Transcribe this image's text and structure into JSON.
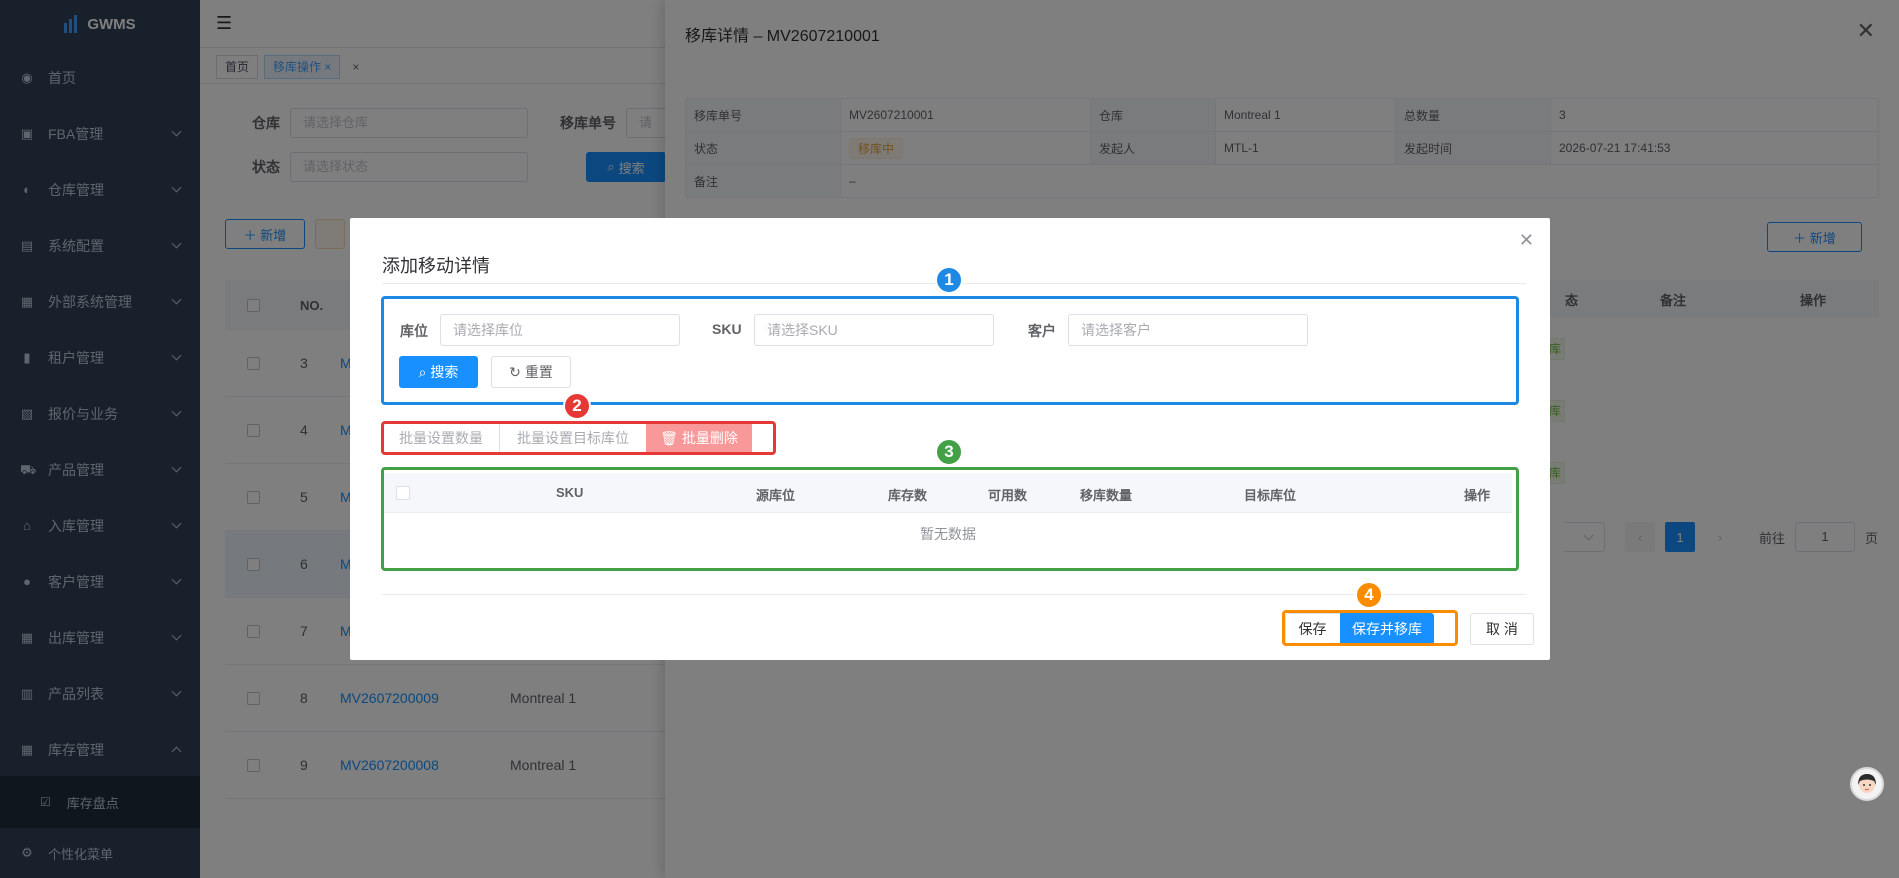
{
  "app": {
    "logo_text": "GWMS"
  },
  "sidebar": {
    "items": [
      {
        "label": "首页",
        "icon": "dashboard-icon"
      },
      {
        "label": "FBA管理",
        "icon": "fba-icon"
      },
      {
        "label": "仓库管理",
        "icon": "warehouse-icon"
      },
      {
        "label": "系统配置",
        "icon": "system-icon"
      },
      {
        "label": "外部系统管理",
        "icon": "grid-icon"
      },
      {
        "label": "租户管理",
        "icon": "chart-icon"
      },
      {
        "label": "报价与业务",
        "icon": "quote-icon"
      },
      {
        "label": "产品管理",
        "icon": "cart-icon"
      },
      {
        "label": "入库管理",
        "icon": "inbound-icon"
      },
      {
        "label": "客户管理",
        "icon": "user-icon"
      },
      {
        "label": "出库管理",
        "icon": "outbound-icon"
      },
      {
        "label": "产品列表",
        "icon": "book-icon"
      },
      {
        "label": "库存管理",
        "icon": "inventory-icon"
      }
    ],
    "sub_item": "库存盘点",
    "personal_menu": "个性化菜单"
  },
  "tags": {
    "home": "首页",
    "active": "移库操作"
  },
  "filters": {
    "warehouse_label": "仓库",
    "warehouse_placeholder": "请选择仓库",
    "move_no_label": "移库单号",
    "move_no_placeholder": "请",
    "status_label": "状态",
    "status_placeholder": "请选择状态",
    "search": "搜索"
  },
  "list": {
    "add": "新增",
    "col_no": "NO.",
    "rows": [
      {
        "no": "3",
        "code": "M"
      },
      {
        "no": "4",
        "code": "M"
      },
      {
        "no": "5",
        "code": "M"
      },
      {
        "no": "6",
        "code": "M"
      },
      {
        "no": "7",
        "code": "M"
      },
      {
        "no": "8",
        "code": "MV2607200009",
        "warehouse": "Montreal 1"
      },
      {
        "no": "9",
        "code": "MV2607200008",
        "warehouse": "Montreal 1"
      }
    ]
  },
  "drawer": {
    "title": "移库详情 – MV2607210001",
    "info": {
      "move_no_label": "移库单号",
      "move_no": "MV2607210001",
      "warehouse_label": "仓库",
      "warehouse": "Montreal 1",
      "total_label": "总数量",
      "total": "3",
      "status_label": "状态",
      "status": "移库中",
      "initiator_label": "发起人",
      "initiator": "MTL-1",
      "time_label": "发起时间",
      "time": "2026-07-21 17:41:53",
      "remark_label": "备注",
      "remark": "–"
    },
    "add": "新增",
    "cols": {
      "status_tail": "态",
      "remark": "备注",
      "op": "操作"
    },
    "tag_text": "库",
    "pager": {
      "current": "1",
      "goto": "前往",
      "goto_value": "1",
      "page": "页"
    }
  },
  "dialog": {
    "title": "添加移动详情",
    "location_label": "库位",
    "location_placeholder": "请选择库位",
    "sku_label": "SKU",
    "sku_placeholder": "请选择SKU",
    "customer_label": "客户",
    "customer_placeholder": "请选择客户",
    "search": "搜索",
    "reset": "重置",
    "batch_qty": "批量设置数量",
    "batch_target": "批量设置目标库位",
    "batch_delete": "批量删除",
    "columns": [
      "SKU",
      "源库位",
      "库存数",
      "可用数",
      "移库数量",
      "目标库位",
      "操作"
    ],
    "empty": "暂无数据",
    "save": "保存",
    "save_move": "保存并移库",
    "cancel": "取 消"
  },
  "annotations": [
    {
      "num": "1",
      "color": "#1e88e5"
    },
    {
      "num": "2",
      "color": "#e53935"
    },
    {
      "num": "3",
      "color": "#43a047"
    },
    {
      "num": "4",
      "color": "#fb8c00"
    }
  ]
}
